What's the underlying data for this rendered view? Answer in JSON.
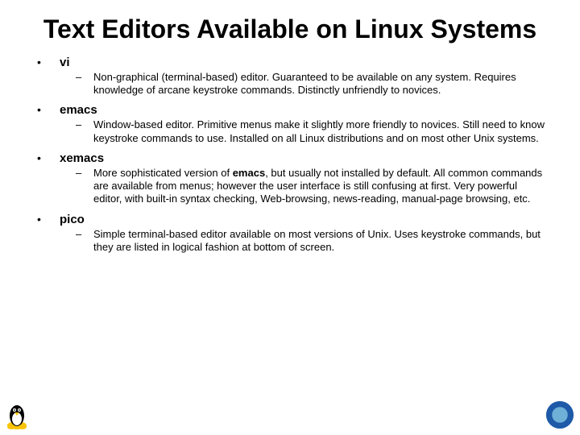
{
  "title": "Text Editors Available on Linux Systems",
  "items": [
    {
      "name": "vi",
      "desc": "Non-graphical (terminal-based) editor. Guaranteed to be available on any system. Requires knowledge of arcane keystroke commands. Distinctly unfriendly to novices."
    },
    {
      "name": "emacs",
      "desc": "Window-based editor. Primitive menus make it slightly more friendly to novices. Still need to know keystroke commands to use. Installed on all Linux distributions and on most other Unix systems."
    },
    {
      "name": "xemacs",
      "desc_pre": "More sophisticated version of ",
      "desc_bold": "emacs",
      "desc_post": ", but usually not installed by default. All common commands are available from menus; however the user interface is still confusing at first. Very powerful editor, with built-in syntax checking, Web-browsing, news-reading, manual-page browsing, etc."
    },
    {
      "name": "pico",
      "desc": "Simple terminal-based editor available on most versions of Unix. Uses keystroke commands, but they are listed in logical fashion at bottom of screen."
    }
  ],
  "glyphs": {
    "bullet": "•",
    "dash": "–"
  }
}
